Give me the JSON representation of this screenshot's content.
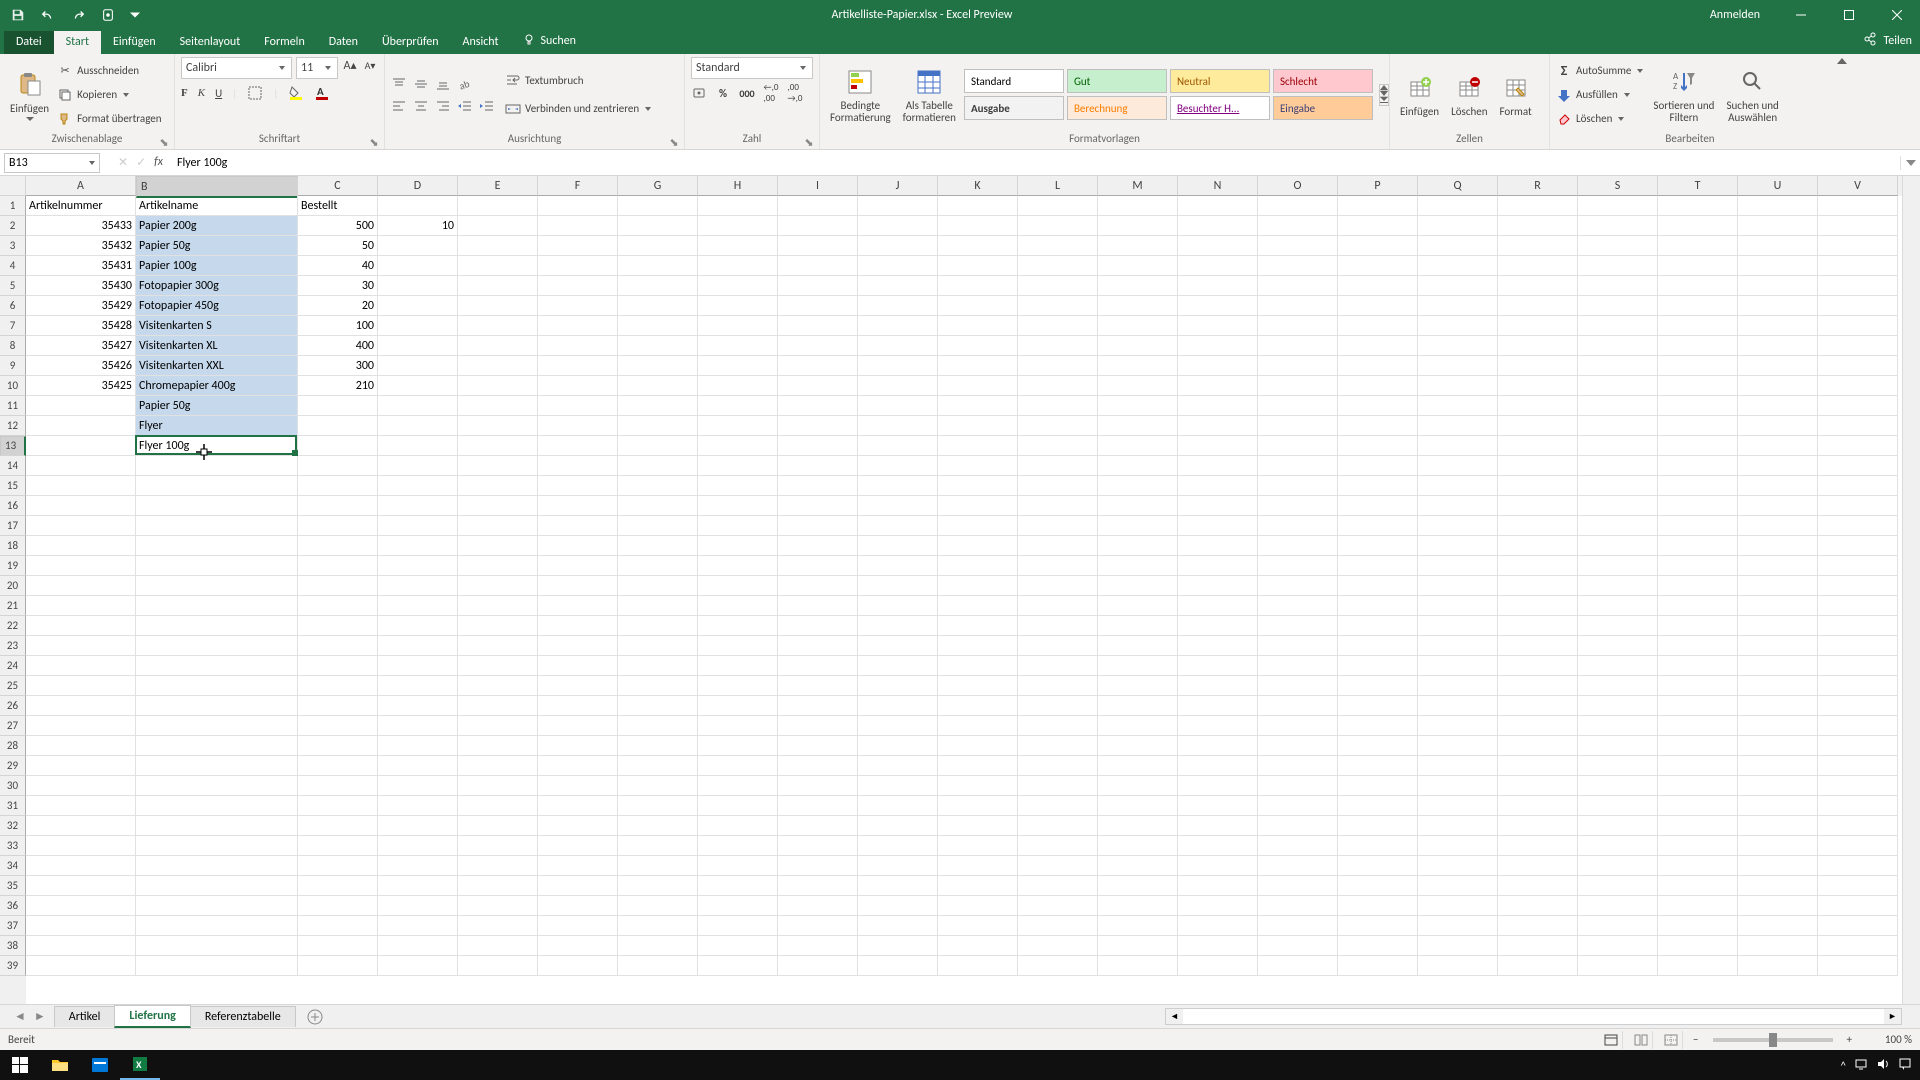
{
  "title": "Artikelliste-Papier.xlsx  -  Excel Preview",
  "signin": "Anmelden",
  "share": "Teilen",
  "tabs": {
    "file": "Datei",
    "home": "Start",
    "insert": "Einfügen",
    "layout": "Seitenlayout",
    "formulas": "Formeln",
    "data": "Daten",
    "review": "Überprüfen",
    "view": "Ansicht",
    "tellme": "Suchen"
  },
  "clipboard": {
    "paste": "Einfügen",
    "cut": "Ausschneiden",
    "copy": "Kopieren",
    "format_painter": "Format übertragen",
    "group": "Zwischenablage"
  },
  "font": {
    "name": "Calibri",
    "size": "11",
    "group": "Schriftart"
  },
  "align": {
    "wrap": "Textumbruch",
    "merge": "Verbinden und zentrieren",
    "group": "Ausrichtung"
  },
  "number": {
    "format": "Standard",
    "group": "Zahl"
  },
  "styles": {
    "cond": "Bedingte\nFormatierung",
    "table": "Als Tabelle\nformatieren",
    "standard": "Standard",
    "gut": "Gut",
    "neutral": "Neutral",
    "schlecht": "Schlecht",
    "ausgabe": "Ausgabe",
    "berechnung": "Berechnung",
    "besucht": "Besuchter H...",
    "eingabe": "Eingabe",
    "group": "Formatvorlagen"
  },
  "cells": {
    "insert": "Einfügen",
    "delete": "Löschen",
    "format": "Format",
    "group": "Zellen"
  },
  "editing": {
    "autosum": "AutoSumme",
    "fill": "Ausfüllen",
    "clear": "Löschen",
    "sort": "Sortieren und\nFiltern",
    "find": "Suchen und\nAuswählen",
    "group": "Bearbeiten"
  },
  "namebox": "B13",
  "formula": "Flyer 100g",
  "columns": [
    "A",
    "B",
    "C",
    "D",
    "E",
    "F",
    "G",
    "H",
    "I",
    "J",
    "K",
    "L",
    "M",
    "N",
    "O",
    "P",
    "Q",
    "R",
    "S",
    "T",
    "U",
    "V"
  ],
  "headers": {
    "A": "Artikelnummer",
    "B": "Artikelname",
    "C": "Bestellt"
  },
  "rows": [
    {
      "A": "35433",
      "B": "Papier 200g",
      "C": "500",
      "D": "10"
    },
    {
      "A": "35432",
      "B": "Papier 50g",
      "C": "50"
    },
    {
      "A": "35431",
      "B": "Papier 100g",
      "C": "40"
    },
    {
      "A": "35430",
      "B": "Fotopapier 300g",
      "C": "30"
    },
    {
      "A": "35429",
      "B": "Fotopapier 450g",
      "C": "20"
    },
    {
      "A": "35428",
      "B": "Visitenkarten S",
      "C": "100"
    },
    {
      "A": "35427",
      "B": "Visitenkarten XL",
      "C": "400"
    },
    {
      "A": "35426",
      "B": "Visitenkarten XXL",
      "C": "300"
    },
    {
      "A": "35425",
      "B": "Chromepapier 400g",
      "C": "210"
    },
    {
      "B": "Papier 50g"
    },
    {
      "B": "Flyer"
    },
    {
      "B": "Flyer 100g"
    }
  ],
  "sheets": {
    "s1": "Artikel",
    "s2": "Lieferung",
    "s3": "Referenztabelle"
  },
  "status": "Bereit",
  "zoom": "100 %",
  "selected_col": "B",
  "selected_row": 13
}
